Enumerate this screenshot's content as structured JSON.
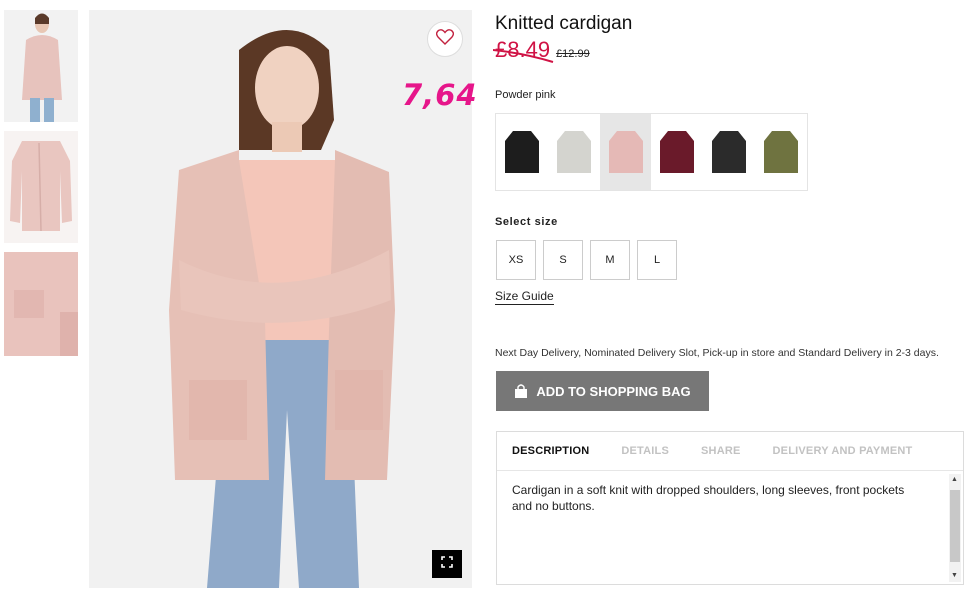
{
  "product": {
    "title": "Knitted cardigan",
    "price_new": "£8.49",
    "price_old": "£12.99",
    "annotation": "7,64",
    "color_name": "Powder pink"
  },
  "colors": {
    "accent_price": "#d01345",
    "annotation": "#e6168a",
    "button_bg": "#777777",
    "swatch_colors": [
      "#1d1d1d",
      "#d4d4cf",
      "#e5b9b6",
      "#6a1a2a",
      "#2b2b2b",
      "#6f7340"
    ]
  },
  "size": {
    "label": "Select size",
    "options": [
      "XS",
      "S",
      "M",
      "L"
    ],
    "guide": "Size Guide"
  },
  "delivery_text": "Next Day Delivery, Nominated Delivery Slot, Pick-up in store and Standard Delivery in 2-3 days.",
  "add_to_bag": "ADD TO SHOPPING BAG",
  "tabs": [
    "DESCRIPTION",
    "DETAILS",
    "SHARE",
    "DELIVERY AND PAYMENT"
  ],
  "description": "Cardigan in a soft knit with dropped shoulders, long sleeves, front pockets and no buttons.",
  "icons": {
    "favorite": "heart-icon",
    "fullscreen": "expand-icon",
    "bag": "shopping-bag-icon"
  }
}
